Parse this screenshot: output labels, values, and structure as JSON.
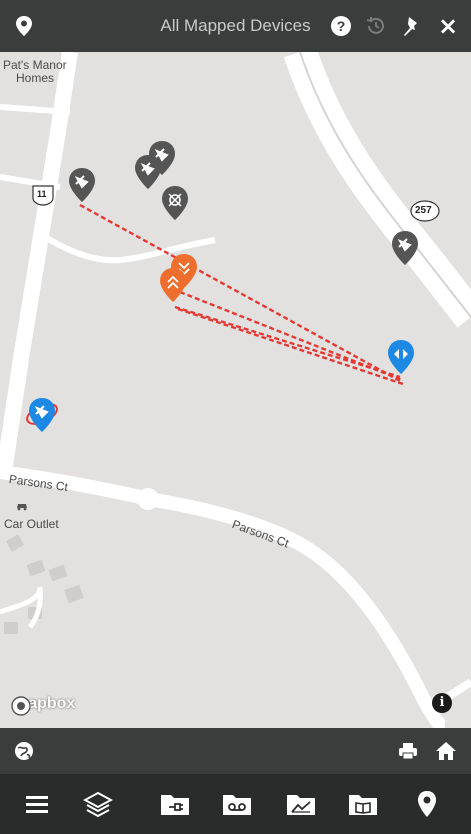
{
  "header": {
    "title": "All Mapped Devices",
    "icons": [
      "map-marker-icon",
      "help-icon",
      "history-icon",
      "pin-icon",
      "close-icon"
    ],
    "close_label": "×"
  },
  "map": {
    "labels": {
      "pats_manor": "Pat's Manor",
      "homes": "Homes",
      "parsons_ct_1": "Parsons Ct",
      "parsons_ct_2": "Parsons Ct",
      "car_outlet": "Car Outlet",
      "route_11": "11",
      "route_257": "257"
    },
    "attribution": "mapbox",
    "info_label": "i",
    "colors": {
      "device_gray": "#555555",
      "device_orange": "#ee6f2d",
      "device_blue": "#1e88e5",
      "link_line": "#e53935",
      "ring": "#e53935"
    }
  },
  "toolbar_secondary": {
    "icons": [
      "globe-icon",
      "print-icon",
      "home-icon"
    ]
  },
  "toolbar_main": {
    "icons": [
      "menu-icon",
      "layers-icon",
      "folder-plug-icon",
      "folder-voicemail-icon",
      "folder-chart-icon",
      "folder-book-icon",
      "location-icon"
    ]
  }
}
